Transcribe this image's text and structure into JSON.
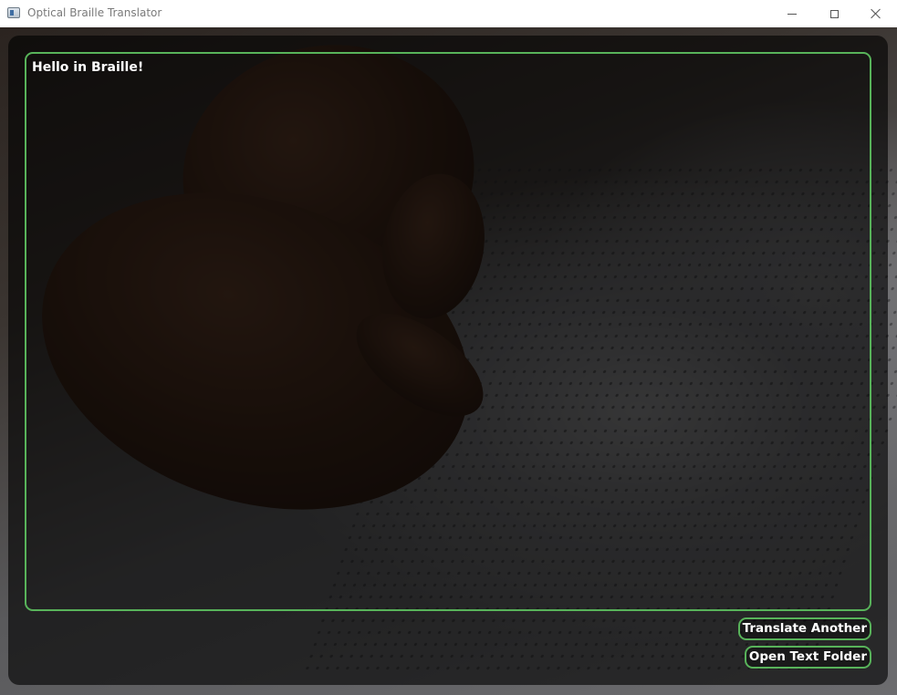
{
  "window": {
    "title": "Optical Braille Translator",
    "icon": "app-window-icon",
    "controls": [
      "minimize-icon",
      "maximize-icon",
      "close-icon"
    ]
  },
  "output": {
    "text": "Hello in Braille!"
  },
  "actions": {
    "translate_another": "Translate Another",
    "open_text_folder": "Open Text Folder"
  },
  "colors": {
    "accent": "#58b35a",
    "text": "#ffffff",
    "overlay": "rgba(0,0,0,0.62)"
  }
}
